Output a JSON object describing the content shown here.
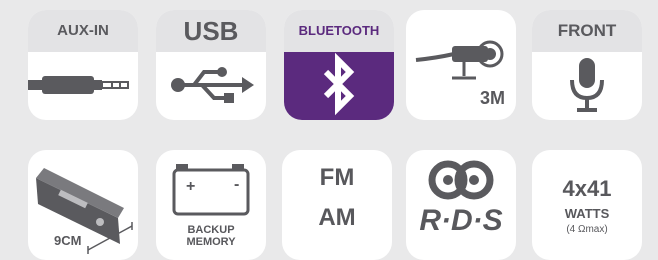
{
  "colors": {
    "background": "#e9e9ea",
    "tile": "#ffffff",
    "header": "#e3e3e5",
    "icon": "#5a5a5e",
    "accent": "#5b2a7e"
  },
  "row1": {
    "aux": {
      "label": "AUX-IN",
      "icon": "aux-cable-icon"
    },
    "usb": {
      "label": "USB",
      "icon": "usb-icon"
    },
    "bluetooth": {
      "label": "BLUETOOTH",
      "icon": "bluetooth-icon"
    },
    "mic3m": {
      "label": "3M",
      "icon": "external-microphone-icon"
    },
    "front": {
      "label": "FRONT",
      "icon": "microphone-icon"
    }
  },
  "row2": {
    "depth": {
      "label": "9CM",
      "icon": "radio-unit-icon"
    },
    "backup": {
      "line1": "BACKUP",
      "line2": "MEMORY",
      "plus": "+",
      "minus": "-",
      "icon": "battery-icon"
    },
    "fmam": {
      "line1": "FM",
      "line2": "AM"
    },
    "rds": {
      "label": "R·D·S",
      "icon": "rds-logo-icon"
    },
    "power": {
      "value": "4x41",
      "unit": "WATTS",
      "note": "(4 Ωmax)"
    }
  }
}
